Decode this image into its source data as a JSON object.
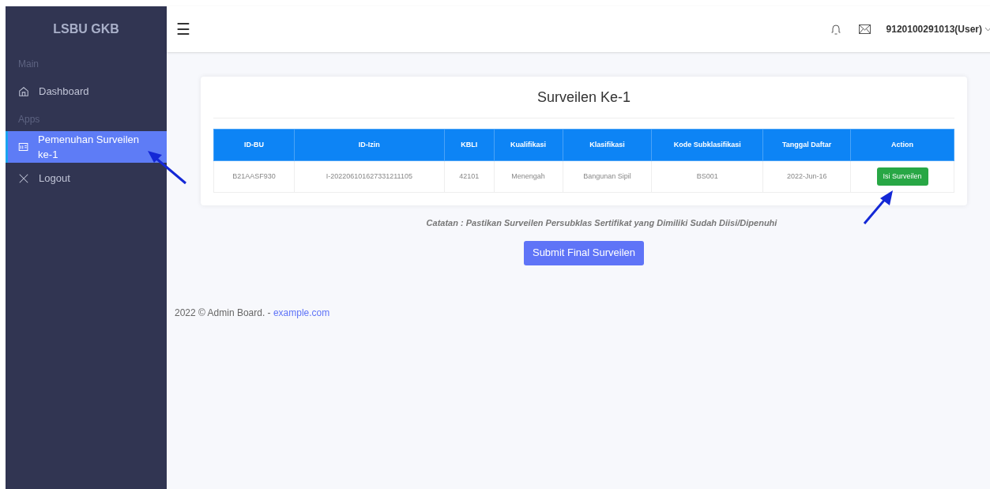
{
  "sidebar": {
    "brand": "LSBU GKB",
    "sections": [
      {
        "label": "Main",
        "items": [
          {
            "kind": "home",
            "label": "Dashboard",
            "selected": false
          }
        ]
      },
      {
        "label": "Apps",
        "items": [
          {
            "kind": "form",
            "label": "Pemenuhan Surveilen ke-1",
            "selected": true
          },
          {
            "kind": "close",
            "label": "Logout",
            "selected": false
          }
        ]
      }
    ]
  },
  "header": {
    "menu_icon": "☰",
    "user": "9120100291013(User)"
  },
  "card": {
    "title": "Surveilen Ke-1",
    "table": {
      "columns": [
        "ID-BU",
        "ID-Izin",
        "KBLI",
        "Kualifikasi",
        "Klasifikasi",
        "Kode Subklasifikasi",
        "Tanggal Daftar",
        "Action"
      ],
      "rows": [
        {
          "cells": [
            "B21AASF930",
            "I-202206101627331211105",
            "42101",
            "Menengah",
            "Bangunan Sipil",
            "BS001",
            "2022-Jun-16"
          ],
          "action": "Isi Surveilen"
        }
      ]
    }
  },
  "note": "Catatan : Pastikan Surveilen Persubklas Sertifikat yang Dimiliki Sudah Diisi/Dipenuhi",
  "submit_button": "Submit Final Surveilen",
  "footer": {
    "text": "2022 © Admin Board. - ",
    "link": "example.com"
  }
}
